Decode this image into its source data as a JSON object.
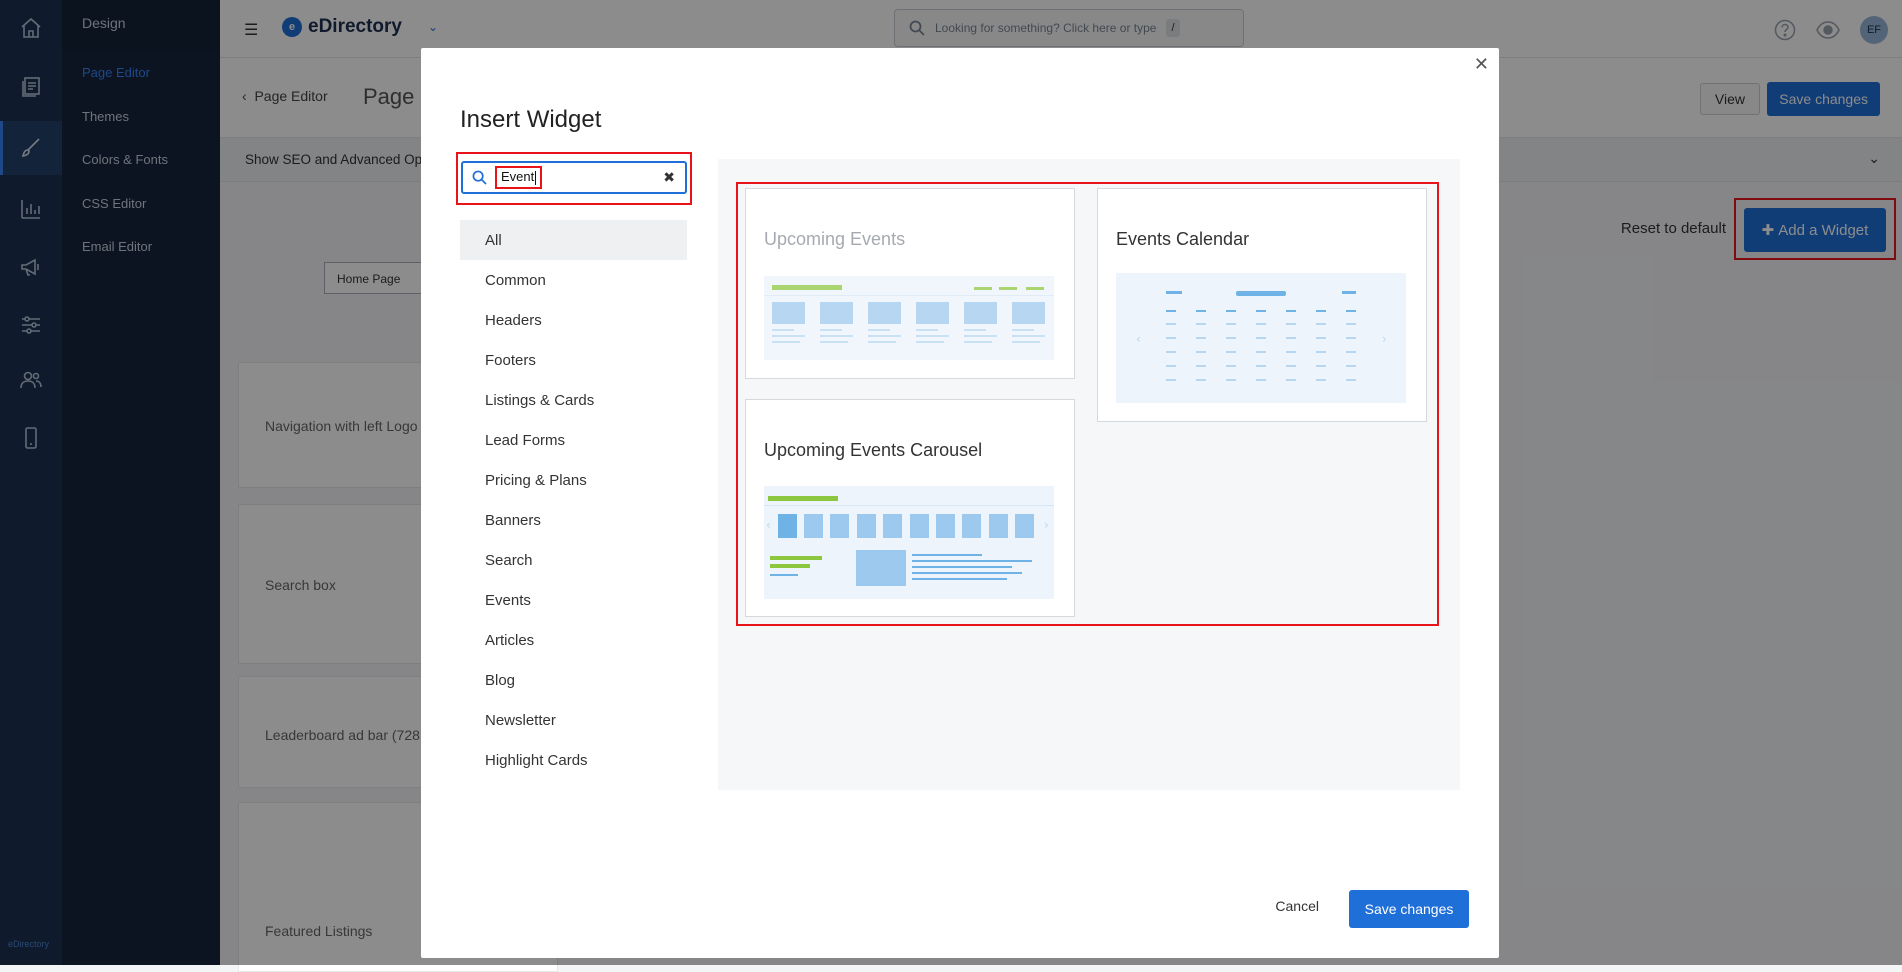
{
  "rail": {
    "icons": [
      "home-icon",
      "pages-icon",
      "brush-icon",
      "bar-chart-icon",
      "megaphone-icon",
      "sliders-icon",
      "users-icon",
      "mobile-icon"
    ],
    "footer_label": "eDirectory"
  },
  "sub_nav": {
    "heading": "Design",
    "items": [
      {
        "label": "Page Editor",
        "active": true
      },
      {
        "label": "Themes"
      },
      {
        "label": "Colors & Fonts"
      },
      {
        "label": "CSS Editor"
      },
      {
        "label": "Email Editor"
      }
    ]
  },
  "topbar": {
    "brand_logo": "e",
    "brand_name": "eDirectory",
    "search_placeholder": "Looking for something? Click here or type",
    "search_shortcut": "/",
    "avatar_initials": "EF"
  },
  "page": {
    "back_label": "Page Editor",
    "title": "Page",
    "view_label": "View",
    "save_label": "Save changes",
    "seo_label": "Show SEO and Advanced Op",
    "reset_label": "Reset to default",
    "add_widget_label": "Add a Widget",
    "home_tab": "Home Page",
    "sections": [
      "Navigation with left Logo",
      "Search box",
      "Leaderboard ad bar (728",
      "Featured Listings"
    ]
  },
  "modal": {
    "title": "Insert Widget",
    "search_value": "Event",
    "categories": [
      "All",
      "Common",
      "Headers",
      "Footers",
      "Listings & Cards",
      "Lead Forms",
      "Pricing & Plans",
      "Banners",
      "Search",
      "Events",
      "Articles",
      "Blog",
      "Newsletter",
      "Highlight Cards"
    ],
    "widgets": [
      {
        "title": "Upcoming Events",
        "disabled": true
      },
      {
        "title": "Events Calendar"
      },
      {
        "title": "Upcoming Events Carousel"
      }
    ],
    "cancel_label": "Cancel",
    "save_label": "Save changes"
  },
  "colors": {
    "primary": "#1f6fd8",
    "highlight": "#e8141a",
    "rail_bg": "#1c3150",
    "thumb_green": "#8dc63f",
    "thumb_blue": "#9ec9ee"
  }
}
